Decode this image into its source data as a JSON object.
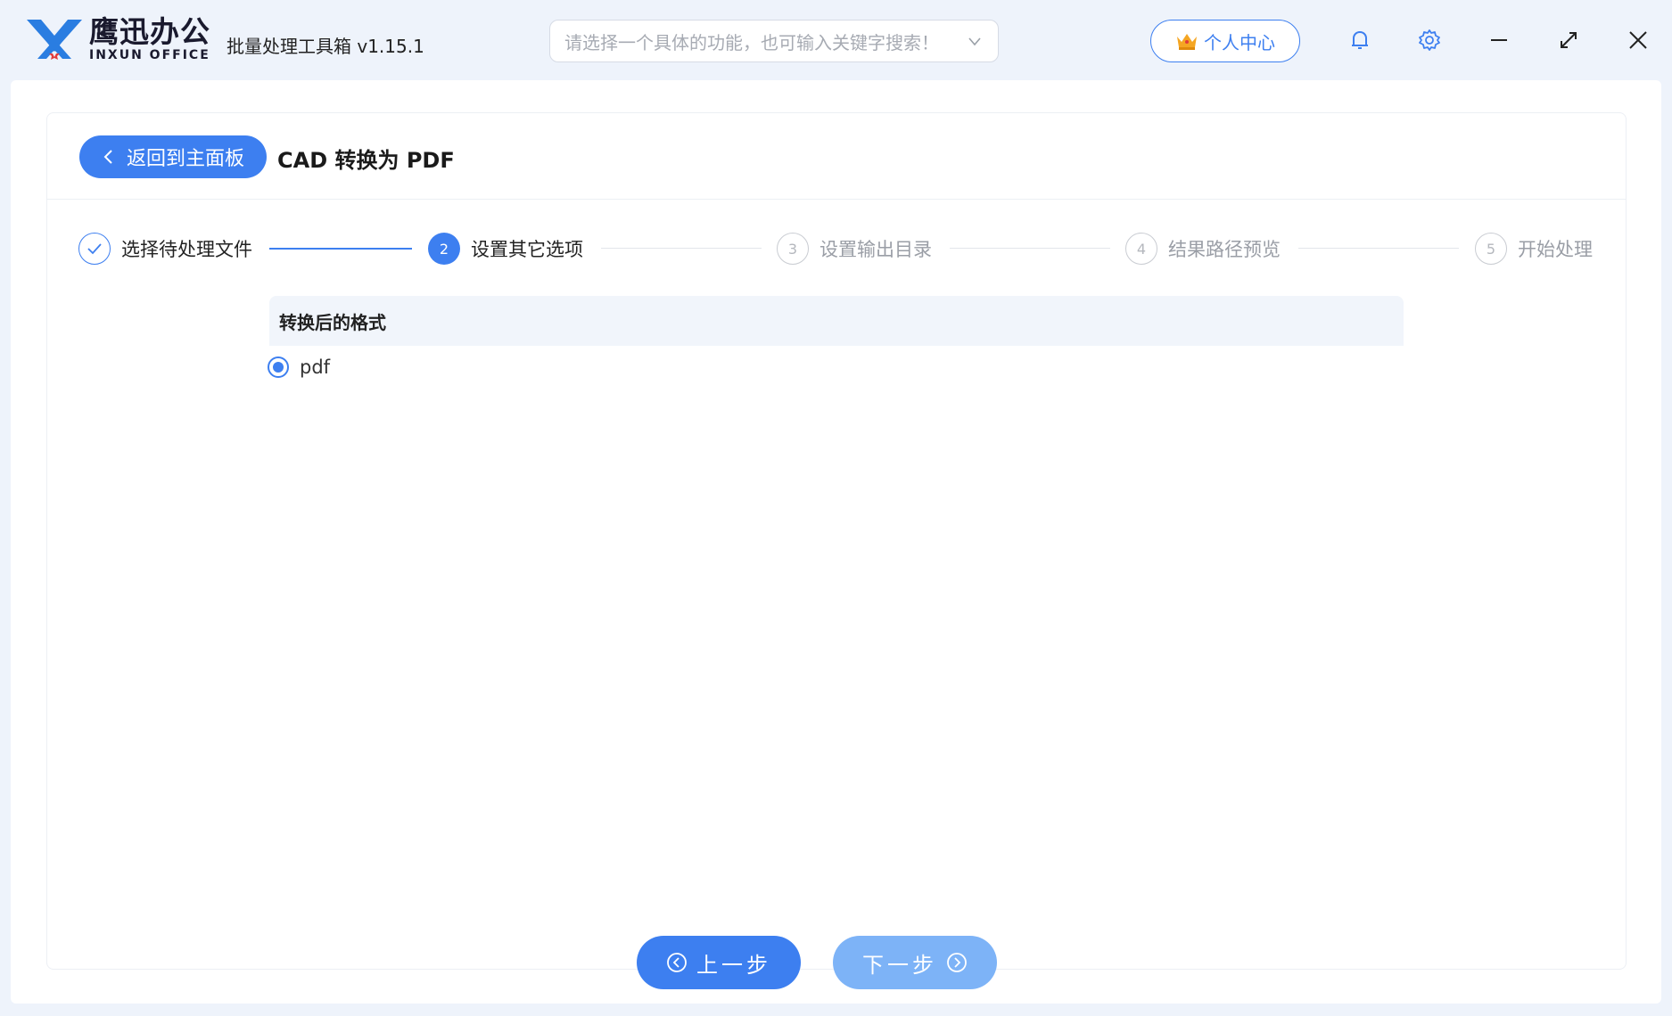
{
  "app": {
    "brand_cn": "鹰迅办公",
    "brand_en": "INXUN OFFICE",
    "title": "批量处理工具箱 v1.15.1"
  },
  "search": {
    "placeholder": "请选择一个具体的功能，也可输入关键字搜索！"
  },
  "header": {
    "user_center_label": "个人中心",
    "icons": [
      "bell-icon",
      "gear-icon",
      "minimize-icon",
      "maximize-icon",
      "close-icon"
    ]
  },
  "page": {
    "back_label": "返回到主面板",
    "title": "CAD 转换为 PDF"
  },
  "steps": [
    {
      "number": "1",
      "label": "选择待处理文件",
      "state": "done"
    },
    {
      "number": "2",
      "label": "设置其它选项",
      "state": "active"
    },
    {
      "number": "3",
      "label": "设置输出目录",
      "state": "todo"
    },
    {
      "number": "4",
      "label": "结果路径预览",
      "state": "todo"
    },
    {
      "number": "5",
      "label": "开始处理",
      "state": "todo"
    }
  ],
  "format_section": {
    "heading": "转换后的格式",
    "options": [
      {
        "label": "pdf",
        "selected": true
      }
    ]
  },
  "nav": {
    "prev_label": "上一步",
    "next_label": "下一步"
  },
  "colors": {
    "accent": "#3d7ff0",
    "accent_light": "#7db3f7",
    "background": "#eef3fb"
  }
}
